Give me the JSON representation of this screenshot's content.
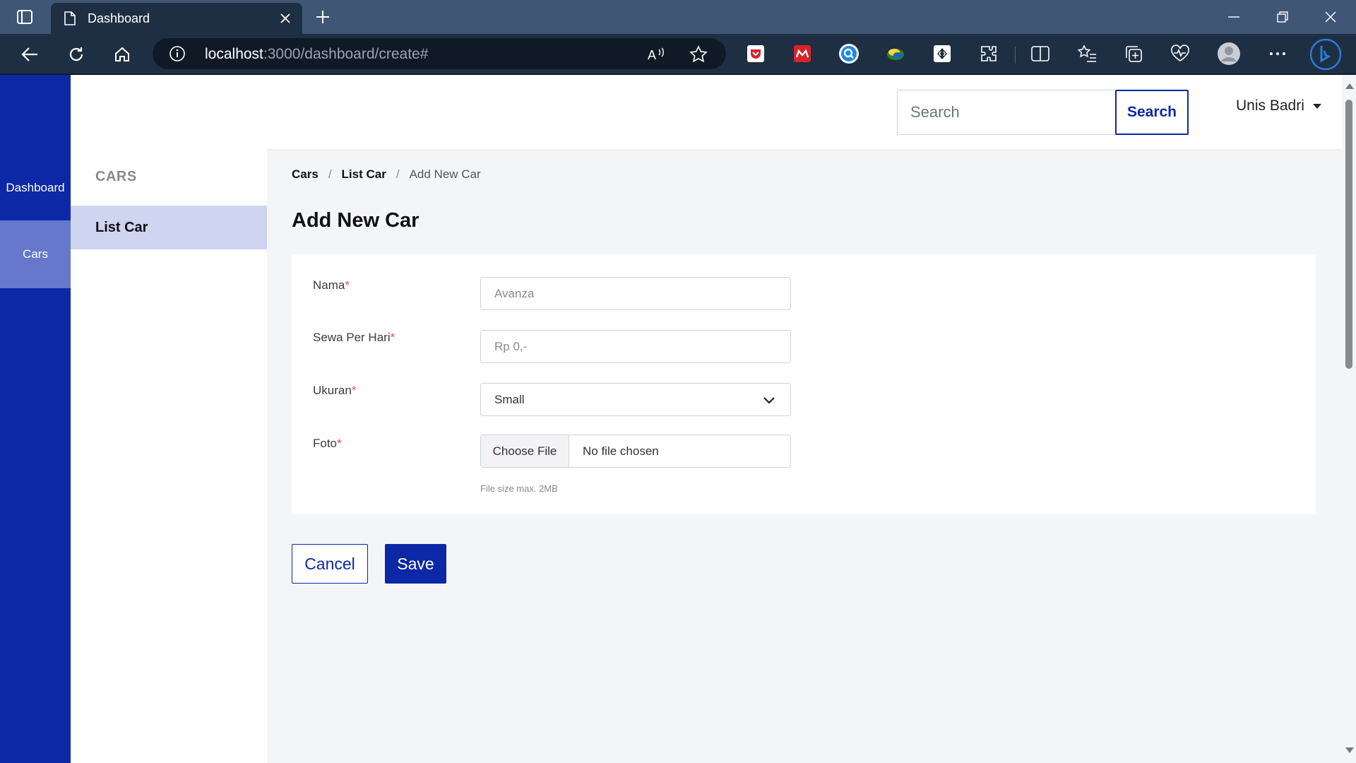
{
  "browser": {
    "tab_title": "Dashboard",
    "url_host": "localhost",
    "url_rest": ":3000/dashboard/create#"
  },
  "rail": {
    "items": [
      {
        "label": "Dashboard"
      },
      {
        "label": "Cars"
      }
    ]
  },
  "topbar": {
    "search_placeholder": "Search",
    "search_button": "Search",
    "user_name": "Unis Badri"
  },
  "subside": {
    "section_title": "CARS",
    "items": [
      {
        "label": "List Car"
      }
    ]
  },
  "breadcrumb": {
    "items": [
      "Cars",
      "List Car"
    ],
    "current": "Add New Car",
    "separator": "/"
  },
  "page": {
    "title": "Add New Car"
  },
  "form": {
    "required_mark": "*",
    "nama": {
      "label": "Nama",
      "placeholder": "Avanza"
    },
    "sewa": {
      "label": "Sewa Per Hari",
      "placeholder": "Rp 0,-"
    },
    "ukuran": {
      "label": "Ukuran",
      "selected": "Small"
    },
    "foto": {
      "label": "Foto",
      "button": "Choose File",
      "status": "No file chosen",
      "hint": "File size max. 2MB"
    }
  },
  "actions": {
    "cancel": "Cancel",
    "save": "Save"
  },
  "colors": {
    "primary": "#0d28a6",
    "active_item": "#cfd4f0",
    "required": "#d9534f"
  },
  "icons": [
    "tab-actions-icon",
    "page-icon",
    "close-icon",
    "plus-icon",
    "minimize-icon",
    "restore-icon",
    "back-icon",
    "refresh-icon",
    "home-icon",
    "info-icon",
    "read-aloud-icon",
    "favorite-star-icon",
    "extensions-icon",
    "split-screen-icon",
    "favorites-icon",
    "collections-icon",
    "browser-essentials-icon",
    "profile-icon",
    "more-icon",
    "bing-icon",
    "chevron-down-icon"
  ]
}
